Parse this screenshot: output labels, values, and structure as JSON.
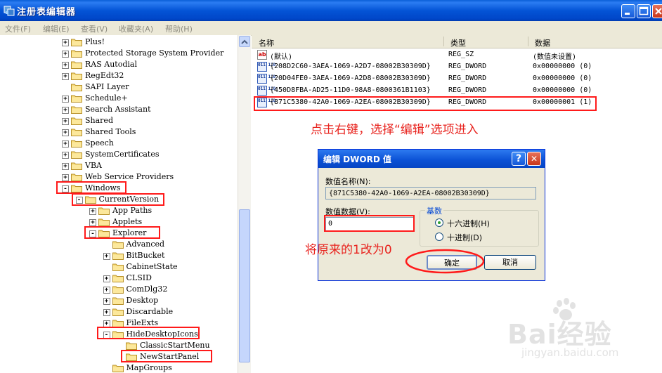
{
  "window": {
    "title": "注册表编辑器"
  },
  "menu": [
    "文件(F)",
    "编辑(E)",
    "查看(V)",
    "收藏夹(A)",
    "帮助(H)"
  ],
  "tree": {
    "items": [
      {
        "label": "Plus!",
        "exp": "+"
      },
      {
        "label": "Protected Storage System Provider",
        "exp": "+"
      },
      {
        "label": "RAS Autodial",
        "exp": "+"
      },
      {
        "label": "RegEdt32",
        "exp": "+"
      },
      {
        "label": "SAPI Layer",
        "exp": ""
      },
      {
        "label": "Schedule+",
        "exp": "+"
      },
      {
        "label": "Search Assistant",
        "exp": "+"
      },
      {
        "label": "Shared",
        "exp": "+"
      },
      {
        "label": "Shared Tools",
        "exp": "+"
      },
      {
        "label": "Speech",
        "exp": "+"
      },
      {
        "label": "SystemCertificates",
        "exp": "+"
      },
      {
        "label": "VBA",
        "exp": "+"
      },
      {
        "label": "Web Service Providers",
        "exp": "+"
      },
      {
        "label": "Windows",
        "exp": "-"
      },
      {
        "label": "CurrentVersion",
        "exp": "-"
      },
      {
        "label": "App Paths",
        "exp": "+"
      },
      {
        "label": "Applets",
        "exp": "+"
      },
      {
        "label": "Explorer",
        "exp": "-"
      },
      {
        "label": "Advanced",
        "exp": ""
      },
      {
        "label": "BitBucket",
        "exp": "+"
      },
      {
        "label": "CabinetState",
        "exp": ""
      },
      {
        "label": "CLSID",
        "exp": "+"
      },
      {
        "label": "ComDlg32",
        "exp": "+"
      },
      {
        "label": "Desktop",
        "exp": "+"
      },
      {
        "label": "Discardable",
        "exp": "+"
      },
      {
        "label": "FileExts",
        "exp": "+"
      },
      {
        "label": "HideDesktopIcons",
        "exp": "-"
      },
      {
        "label": "ClassicStartMenu",
        "exp": ""
      },
      {
        "label": "NewStartPanel",
        "exp": ""
      },
      {
        "label": "MapGroups",
        "exp": ""
      }
    ]
  },
  "list": {
    "headers": [
      "名称",
      "类型",
      "数据"
    ],
    "rows": [
      {
        "icon": "string-value-icon",
        "name": "(默认)",
        "type": "REG_SZ",
        "data": "(数值未设置)"
      },
      {
        "icon": "binary-value-icon",
        "name": "{208D2C60-3AEA-1069-A2D7-08002B30309D}",
        "type": "REG_DWORD",
        "data": "0x00000000 (0)"
      },
      {
        "icon": "binary-value-icon",
        "name": "{20D04FE0-3AEA-1069-A2D8-08002B30309D}",
        "type": "REG_DWORD",
        "data": "0x00000000 (0)"
      },
      {
        "icon": "binary-value-icon",
        "name": "{450D8FBA-AD25-11D0-98A8-0800361B1103}",
        "type": "REG_DWORD",
        "data": "0x00000000 (0)"
      },
      {
        "icon": "binary-value-icon",
        "name": "{871C5380-42A0-1069-A2EA-08002B30309D}",
        "type": "REG_DWORD",
        "data": "0x00000001 (1)"
      }
    ]
  },
  "annotations": {
    "right_click": "点击右键，选择“编辑”选项进入",
    "change": "将原来的1改为0"
  },
  "dialog": {
    "title": "编辑 DWORD 值",
    "help_symbol": "?",
    "close_symbol": "✕",
    "name_label": "数值名称(N):",
    "name_value": "{871C5380-42A0-1069-A2EA-08002B30309D}",
    "data_label": "数值数据(V):",
    "data_value": "0",
    "base_label": "基数",
    "hex_label": "十六进制(H)",
    "dec_label": "十进制(D)",
    "ok": "确定",
    "cancel": "取消"
  },
  "watermark": {
    "brand": "Bai经验",
    "url": "jingyan.baidu.com"
  },
  "colors": {
    "annotation": "#ff1a1a",
    "titlebar": "#0454d6"
  }
}
